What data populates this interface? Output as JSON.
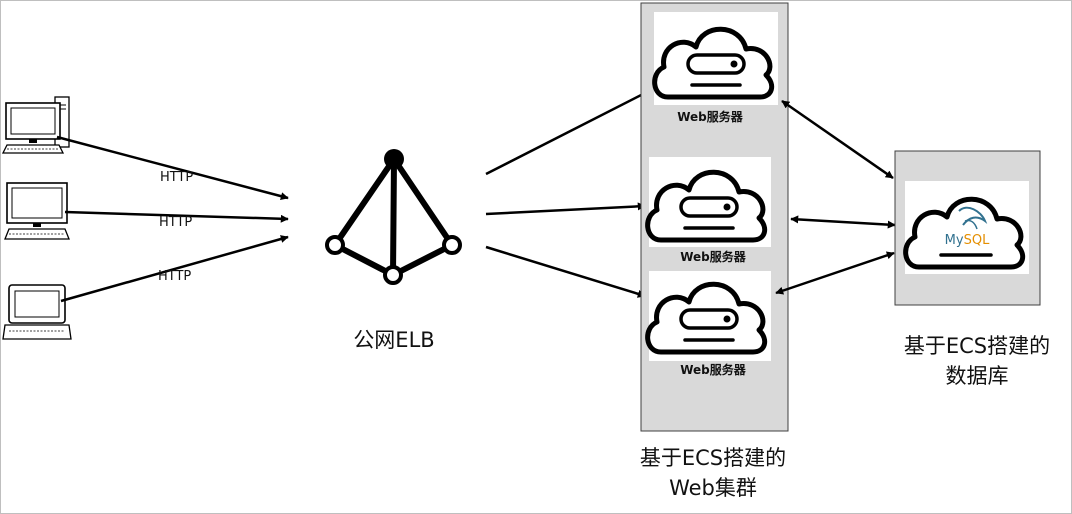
{
  "protocol_labels": [
    "HTTP",
    "HTTP",
    "HTTP"
  ],
  "elb_label": "公网ELB",
  "web_server_labels": [
    "Web服务器",
    "Web服务器",
    "Web服务器"
  ],
  "web_cluster_caption": [
    "基于ECS搭建的",
    "Web集群"
  ],
  "database_caption": [
    "基于ECS搭建的",
    "数据库"
  ],
  "mysql_logo_text": "MySQL",
  "colors": {
    "panel_fill": "#d9d9d9",
    "panel_stroke": "#404040",
    "mysql_blue": "#31718f",
    "mysql_orange": "#e48e00"
  }
}
